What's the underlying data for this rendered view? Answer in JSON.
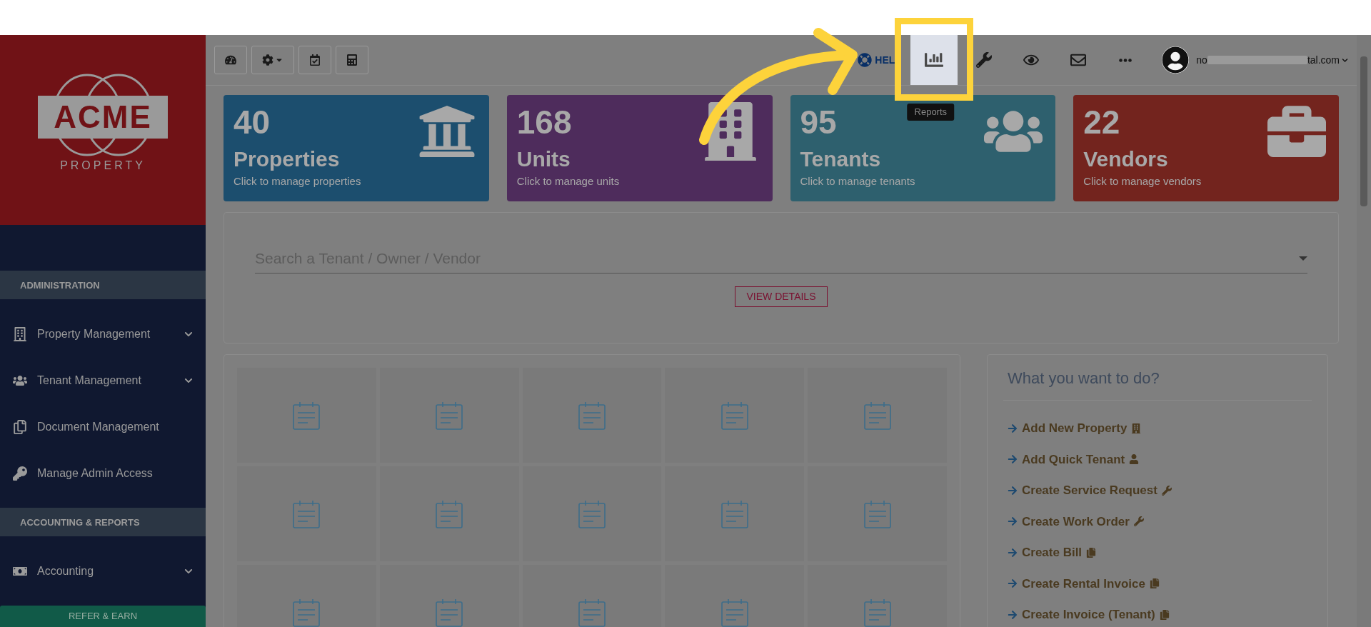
{
  "sidebar": {
    "logo": {
      "word": "ACME",
      "sub": "PROPERTY"
    },
    "sections": [
      {
        "title": "ADMINISTRATION",
        "items": [
          {
            "label": "Property Management",
            "has_submenu": true
          },
          {
            "label": "Tenant Management",
            "has_submenu": true
          },
          {
            "label": "Document Management",
            "has_submenu": false
          },
          {
            "label": "Manage Admin Access",
            "has_submenu": false
          }
        ]
      },
      {
        "title": "ACCOUNTING & REPORTS",
        "items": [
          {
            "label": "Accounting",
            "has_submenu": true
          }
        ]
      }
    ],
    "footer_button": "REFER & EARN"
  },
  "top_bar": {
    "left_tools": [
      {
        "kind": "dashboard"
      },
      {
        "kind": "settings"
      },
      {
        "kind": "calendar"
      },
      {
        "kind": "calculator"
      }
    ],
    "right_tools": [
      {
        "kind": "help",
        "label": "HEL",
        "selected": false
      },
      {
        "kind": "reports",
        "selected": true,
        "tooltip": "Reports"
      },
      {
        "kind": "wrench",
        "selected": false
      },
      {
        "kind": "eye",
        "selected": false
      },
      {
        "kind": "mail",
        "selected": false
      },
      {
        "kind": "more",
        "selected": false
      }
    ],
    "user": {
      "email_start": "no",
      "email_end": "tal.com"
    }
  },
  "cards": [
    {
      "count": "40",
      "title": "Properties",
      "subtitle": "Click to manage properties",
      "color": "#1c4e6e"
    },
    {
      "count": "168",
      "title": "Units",
      "subtitle": "Click to manage units",
      "color": "#4e2c5c"
    },
    {
      "count": "95",
      "title": "Tenants",
      "subtitle": "Click to manage tenants",
      "color": "#2e606e"
    },
    {
      "count": "22",
      "title": "Vendors",
      "subtitle": "Click to manage vendors",
      "color": "#73241e"
    }
  ],
  "search": {
    "placeholder": "Search a Tenant / Owner / Vendor",
    "button": "VIEW DETAILS"
  },
  "quick_actions": {
    "title": "What you want to do?",
    "items": [
      {
        "label": "Add New Property",
        "kind": "building"
      },
      {
        "label": "Add Quick Tenant",
        "kind": "user"
      },
      {
        "label": "Create Service Request",
        "kind": "wrench"
      },
      {
        "label": "Create Work Order",
        "kind": "wrench"
      },
      {
        "label": "Create Bill",
        "kind": "copy"
      },
      {
        "label": "Create Rental Invoice",
        "kind": "copy"
      },
      {
        "label": "Create Invoice (Tenant)",
        "kind": "copy"
      }
    ]
  }
}
